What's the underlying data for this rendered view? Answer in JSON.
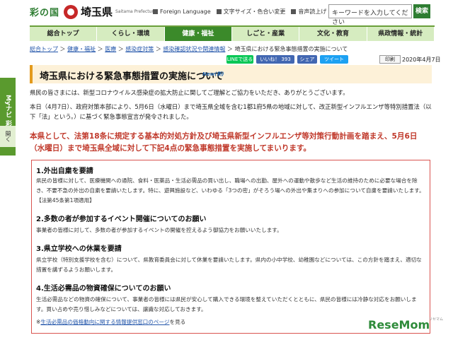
{
  "header": {
    "logo_main": "彩の国",
    "logo_pref": "埼玉県",
    "logo_en": "Saitama Prefecture",
    "links": [
      "Foreign Language",
      "文字サイズ・色合い変更",
      "音声読上げ"
    ],
    "search_placeholder": "キーワードを入力してください",
    "search_button": "検索"
  },
  "nav": [
    "総合トップ",
    "くらし・環境",
    "健康・福祉",
    "しごと・産業",
    "文化・教育",
    "県政情報・統計"
  ],
  "nav_active": 2,
  "sidetab": {
    "main": "Myナビ 彩の国",
    "open": "開く"
  },
  "breadcrumb": [
    "総合トップ",
    "健康・福祉",
    "医療",
    "感染症対策",
    "感染確認状況や関連情報",
    "埼玉県における緊急事態措置の実施について"
  ],
  "share": {
    "line": "LINEで送る",
    "like": "いいね！ 393",
    "share": "シェア",
    "tweet": "ツイート"
  },
  "print_label": "印刷",
  "date": "2020年4月7日",
  "title": "埼玉県における緊急事態措置の実施について",
  "new_badge": "New(新)",
  "intro1": "県民の皆さまには、新型コロナウイルス感染症の拡大防止に関してご理解とご協力をいただき、ありがとうございます。",
  "intro2": "本日（4月7日）、政府対策本部により、5月6日（水曜日）まで埼玉県全域を含む1都1府5県の地域に対して、改正新型インフルエンザ等特別措置法（以下「法」という。）に基づく緊急事態宣言が発令されました。",
  "lead": "本県として、法第18条に規定する基本的対処方針及び埼玉県新型インフルエンザ等対策行動計画を踏まえ、5月6日（水曜日）まで埼玉県全域に対して下記4点の緊急事態措置を実施してまいります。",
  "sections": [
    {
      "heading": "1.外出自粛を要請",
      "text": "県民の皆様に対して、医療機関への通院、食料・医薬品・生活必需品の買い出し、職場への出勤、屋外への運動や散歩など生活の維持のために必要な場合を除き、不要不急の外出の自粛を要請いたします。特に、遊興施設など、いわゆる「3つの密」がそろう場への外出や集まりへの参加について自粛を要請いたします。【法第45条第1項適用】"
    },
    {
      "heading": "2.多数の者が参加するイベント開催についてのお願い",
      "text": "事業者の皆様に対して、多数の者が参加するイベントの開催を控えるよう御協力をお願いいたします。"
    },
    {
      "heading": "3.県立学校への休業を要請",
      "text": "県立学校（特別支援学校を含む）について、県教育委員会に対して休業を要請いたします。県内の小中学校、幼稚園などについては、この方針を踏まえ、適切な措置を講ずるようお願いします。"
    },
    {
      "heading": "4.生活必需品の物資確保についてのお願い",
      "text": "生活必需品などの物資の確保について、事業者の皆様には県民が安心して購入できる環境を整えていただくとともに、県民の皆様には冷静な対応をお願いします。買い占めや売り惜しみなどについては、譲識な対応しておきます。"
    }
  ],
  "footer_link_mark": "※",
  "footer_link": "生活必需品の価格動向に関する情報提供窓口のページ",
  "footer_suffix": "を見る",
  "watermark": "ReseMom",
  "watermark_small": "リセマム"
}
